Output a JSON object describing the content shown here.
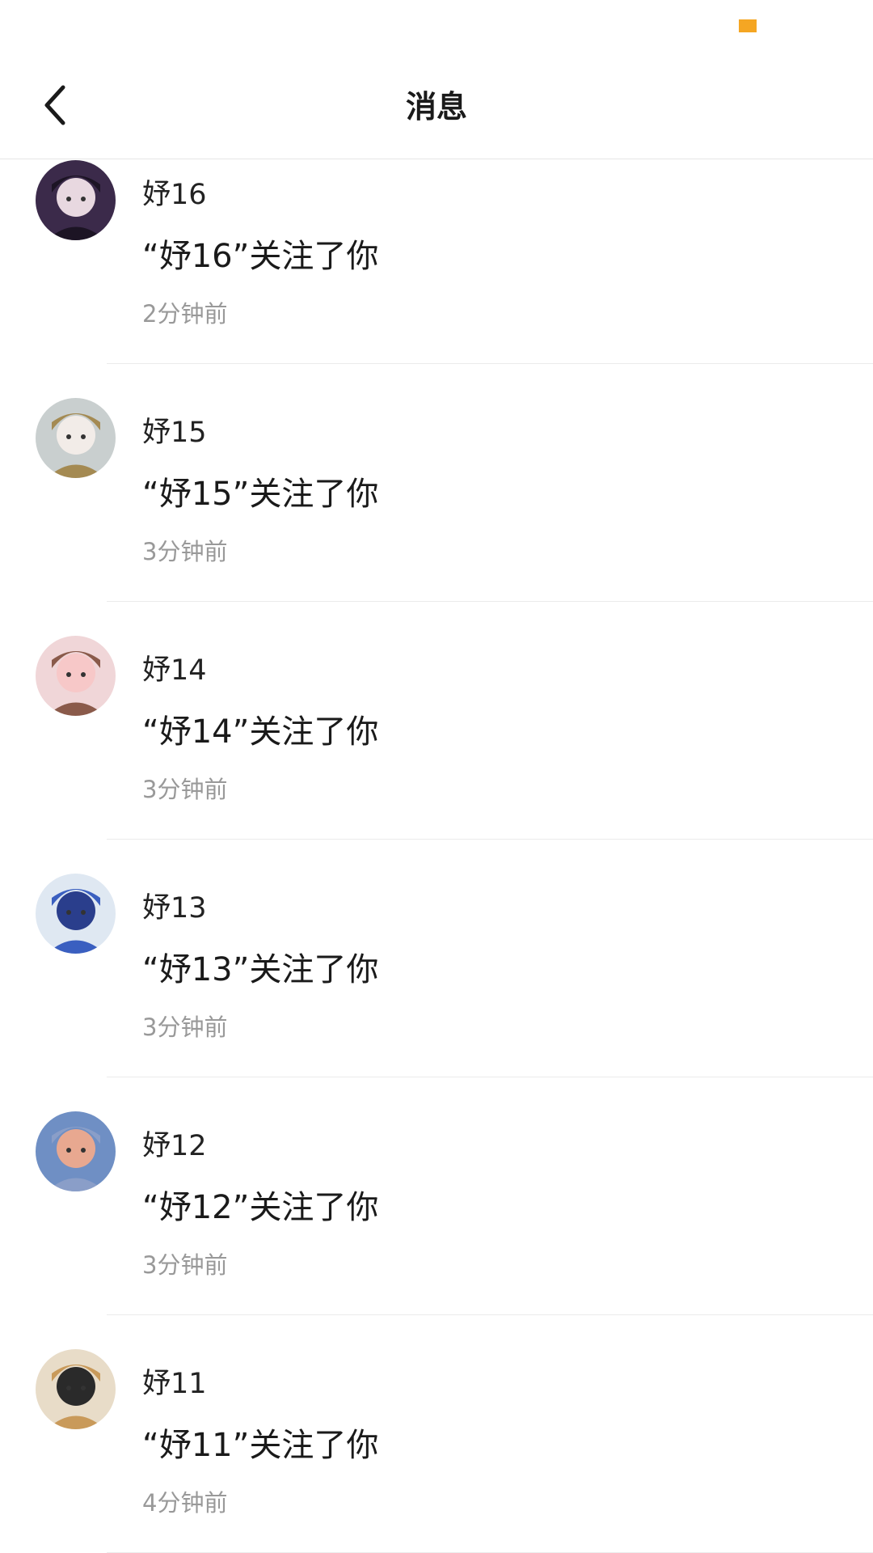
{
  "header": {
    "title": "消息",
    "back_icon": "chevron-left-icon",
    "status_indicator_color": "#f5a623"
  },
  "notifications": [
    {
      "name": "妤16",
      "message": "“妤16”关注了你",
      "time": "2分钟前",
      "avatar": {
        "bg": "#3b2a4a",
        "fg": "#e8d8e0",
        "accent": "#1c1424"
      }
    },
    {
      "name": "妤15",
      "message": "“妤15”关注了你",
      "time": "3分钟前",
      "avatar": {
        "bg": "#c9cfcf",
        "fg": "#f2ece8",
        "accent": "#a48a52"
      }
    },
    {
      "name": "妤14",
      "message": "“妤14”关注了你",
      "time": "3分钟前",
      "avatar": {
        "bg": "#f0d6d8",
        "fg": "#f7c8c8",
        "accent": "#8a5a4a"
      }
    },
    {
      "name": "妤13",
      "message": "“妤13”关注了你",
      "time": "3分钟前",
      "avatar": {
        "bg": "#dfe8f2",
        "fg": "#2a3e8c",
        "accent": "#3a5fc0"
      }
    },
    {
      "name": "妤12",
      "message": "“妤12”关注了你",
      "time": "3分钟前",
      "avatar": {
        "bg": "#6f8fc4",
        "fg": "#e8a890",
        "accent": "#8a9ec8"
      }
    },
    {
      "name": "妤11",
      "message": "“妤11”关注了你",
      "time": "4分钟前",
      "avatar": {
        "bg": "#e8dcc8",
        "fg": "#2a2a2a",
        "accent": "#c99a5a"
      }
    }
  ]
}
